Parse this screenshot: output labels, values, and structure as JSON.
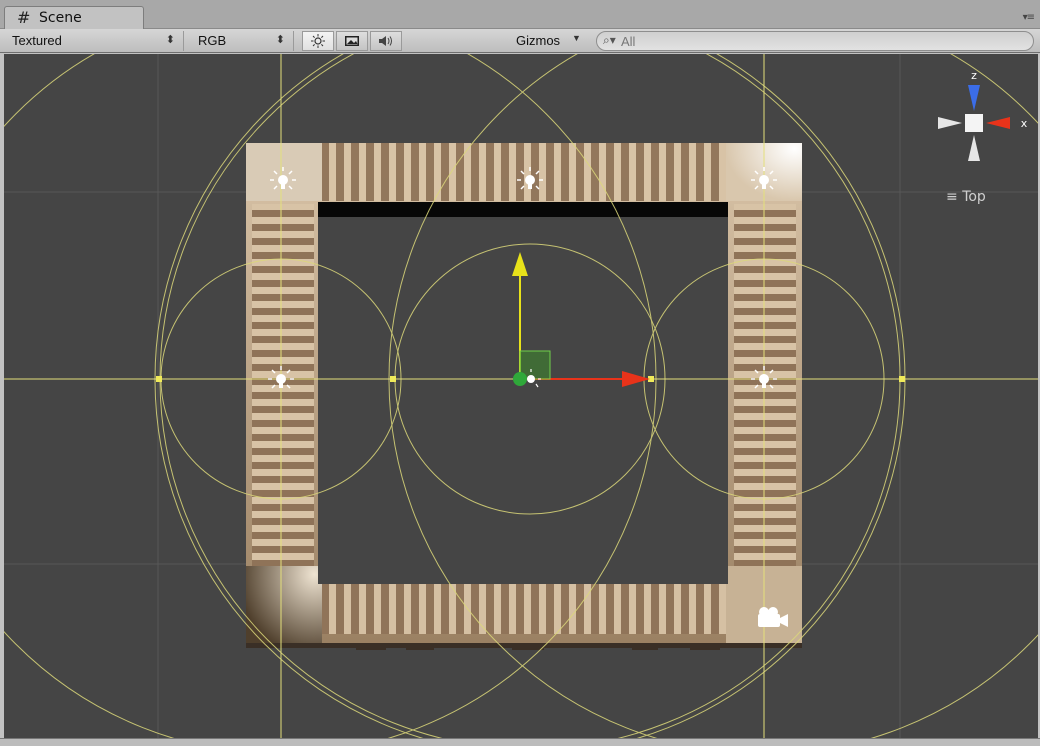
{
  "tab": {
    "icon": "hash-icon",
    "title": "Scene"
  },
  "toolbar": {
    "draw_mode": "Textured",
    "render_mode": "RGB",
    "gizmos_label": "Gizmos",
    "search_value": "All",
    "buttons": [
      {
        "name": "scene-lighting-toggle",
        "icon": "sun-icon",
        "active": true
      },
      {
        "name": "scene-fx-toggle",
        "icon": "image-icon",
        "active": false
      },
      {
        "name": "audio-toggle",
        "icon": "speaker-icon",
        "active": false
      }
    ]
  },
  "gizmo": {
    "view_label": "Top",
    "axis_y": "z",
    "axis_x": "x"
  },
  "colors": {
    "viewport_bg": "#454545",
    "grid_line": "#5a5a5a",
    "light_range": "#e6e27a",
    "axis_x": "#e8331a",
    "axis_y": "#e8e21a",
    "axis_z": "#3b6de8",
    "wall": "#c9b296"
  }
}
